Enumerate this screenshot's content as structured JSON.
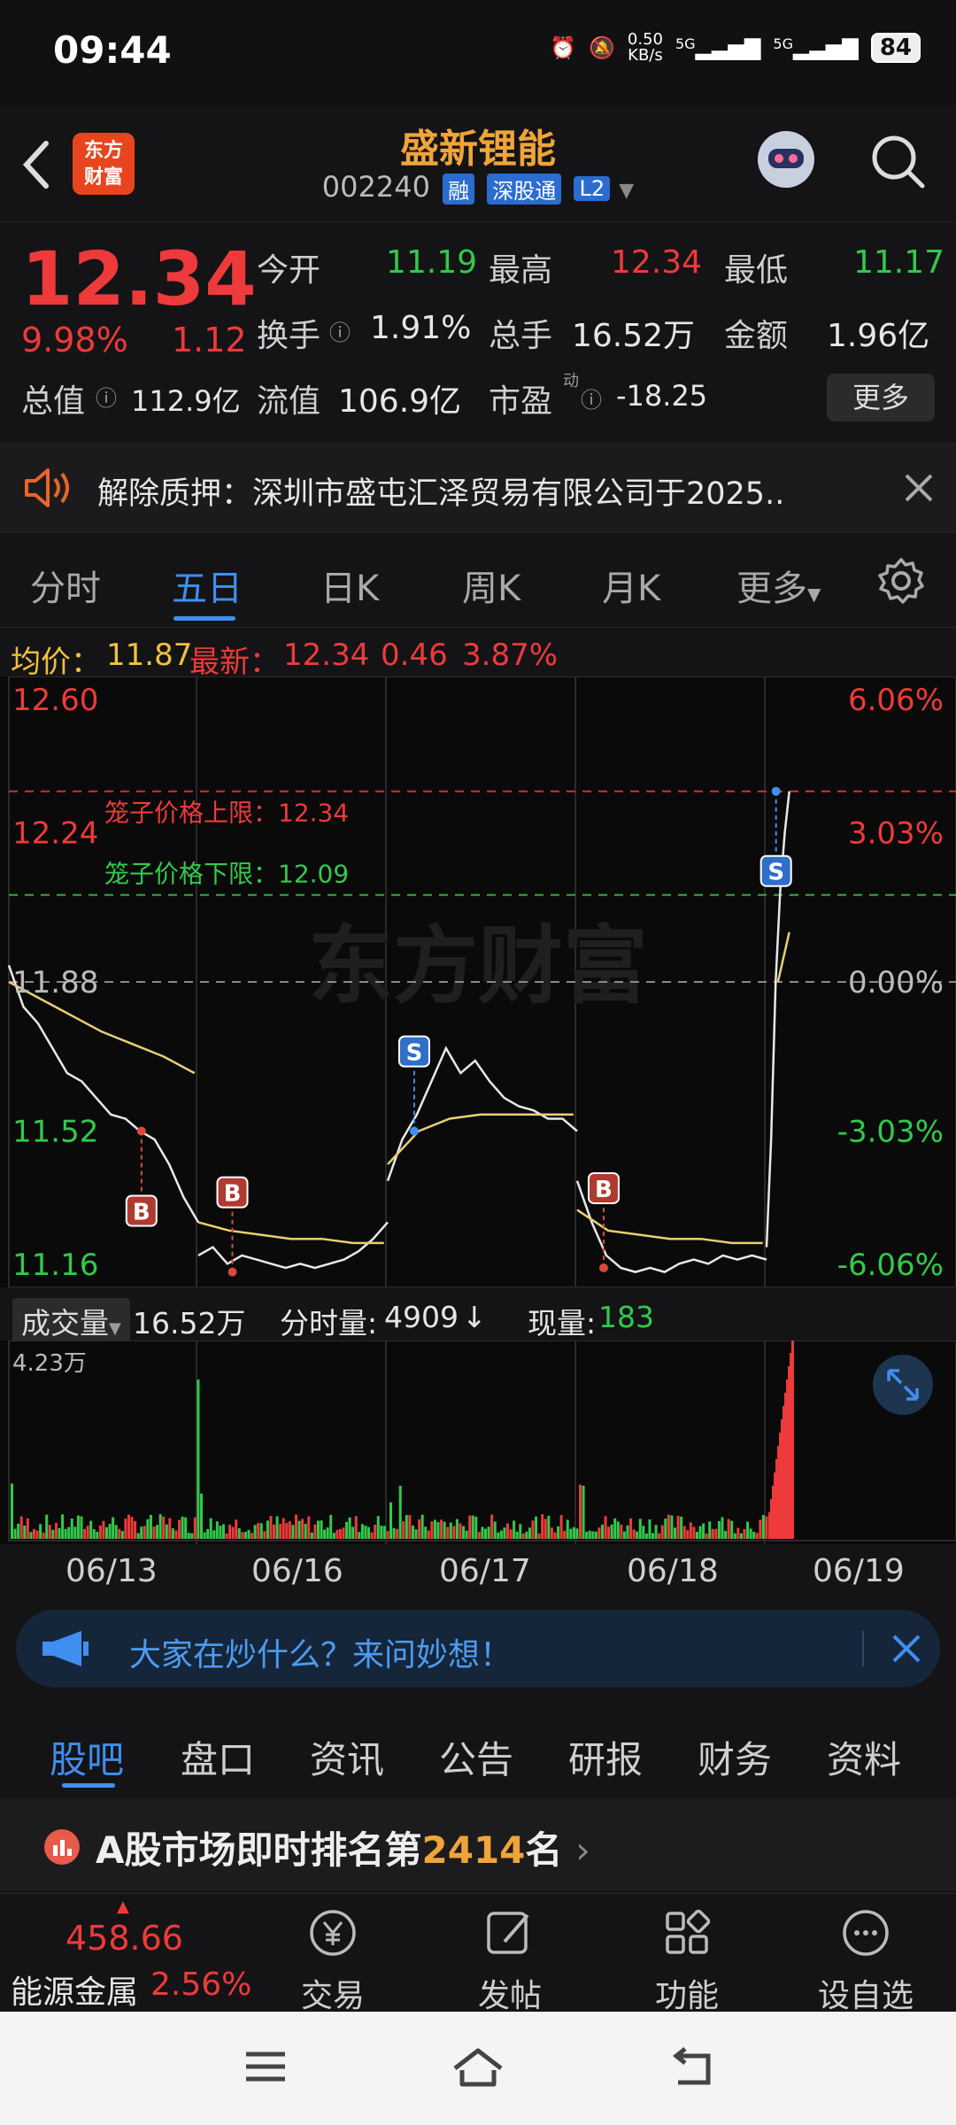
{
  "status_bar": {
    "time": "09:44",
    "net_speed_value": "0.50",
    "net_speed_unit": "KB/s",
    "sim1": "5G",
    "sim2": "5G",
    "battery": "84"
  },
  "header": {
    "logo_line1": "东方",
    "logo_line2": "财富",
    "stock_name": "盛新锂能",
    "stock_code": "002240",
    "tags": [
      "融",
      "深股通",
      "L2"
    ]
  },
  "quote": {
    "price": "12.34",
    "change_pct": "9.98%",
    "change": "1.12",
    "open_label": "今开",
    "open": "11.19",
    "high_label": "最高",
    "high": "12.34",
    "low_label": "最低",
    "low": "11.17",
    "turnover_label": "换手",
    "turnover": "1.91%",
    "volume_label": "总手",
    "volume": "16.52万",
    "amount_label": "金额",
    "amount": "1.96亿",
    "mcap_label": "总值",
    "mcap": "112.9亿",
    "float_label": "流值",
    "float": "106.9亿",
    "pe_label": "市盈",
    "pe_sup": "动",
    "pe": "-18.25",
    "more": "更多"
  },
  "notice": {
    "text": "解除质押：深圳市盛屯汇泽贸易有限公司于2025.."
  },
  "tabs": [
    "分时",
    "五日",
    "日K",
    "周K",
    "月K",
    "更多",
    ""
  ],
  "tabs_active": "五日",
  "chart_info": {
    "avg_label": "均价：",
    "avg": "11.87",
    "last_label": "最新：",
    "last": "12.34",
    "chg": "0.46",
    "chg_pct": "3.87%"
  },
  "chart_data": {
    "type": "line",
    "x": [
      "06/13",
      "06/16",
      "06/17",
      "06/18",
      "06/19"
    ],
    "y_ticks_left": [
      "12.60",
      "12.24",
      "11.88",
      "11.52",
      "11.16"
    ],
    "y_ticks_right": [
      "6.06%",
      "3.03%",
      "0.00%",
      "-3.03%",
      "-6.06%"
    ],
    "ylim": [
      11.16,
      12.6
    ],
    "cage_upper_label": "笼子价格上限：12.34",
    "cage_lower_label": "笼子价格下限：12.09",
    "cage_upper": 12.34,
    "cage_lower": 12.09,
    "prev_close": 11.88,
    "watermark": "东方财富",
    "series": [
      {
        "values_day1": [
          11.92,
          11.82,
          11.78,
          11.72,
          11.66,
          11.64,
          11.6,
          11.56,
          11.55,
          11.52,
          11.5,
          11.44,
          11.36,
          11.3
        ]
      },
      {
        "values_day2": [
          11.22,
          11.24,
          11.2,
          11.22,
          11.21,
          11.2,
          11.19,
          11.2,
          11.19,
          11.2,
          11.21,
          11.23,
          11.26,
          11.3
        ]
      },
      {
        "values_day3": [
          11.4,
          11.5,
          11.56,
          11.64,
          11.72,
          11.66,
          11.69,
          11.64,
          11.6,
          11.58,
          11.57,
          11.55,
          11.55,
          11.52
        ]
      },
      {
        "values_day4": [
          11.4,
          11.3,
          11.22,
          11.19,
          11.18,
          11.19,
          11.18,
          11.2,
          11.21,
          11.2,
          11.22,
          11.21,
          11.22,
          11.21
        ]
      },
      {
        "values_day5": [
          11.24,
          11.5,
          11.88,
          12.1,
          12.24,
          12.34
        ]
      }
    ],
    "avg_series": [
      {
        "values_day1": [
          11.88,
          11.84,
          11.8,
          11.76,
          11.73,
          11.7,
          11.66
        ]
      },
      {
        "values_day2": [
          11.3,
          11.28,
          11.27,
          11.26,
          11.26,
          11.25,
          11.25
        ]
      },
      {
        "values_day3": [
          11.44,
          11.52,
          11.55,
          11.56,
          11.56,
          11.56,
          11.56
        ]
      },
      {
        "values_day4": [
          11.33,
          11.28,
          11.27,
          11.26,
          11.26,
          11.25,
          11.25
        ]
      },
      {
        "values_day5": [
          11.88,
          12.0
        ]
      }
    ],
    "trade_markers": [
      "B",
      "B",
      "S",
      "B",
      "S"
    ],
    "trade_markers_info": "B/S"
  },
  "volume_info": {
    "label": "成交量",
    "total": "16.52万",
    "tick_label": "分时量:",
    "tick": "4909",
    "tick_arrow": "↓",
    "now_label": "现量:",
    "now": "183",
    "max": "4.23万"
  },
  "ask": {
    "text": "大家在炒什么？来问妙想！"
  },
  "bottom_tabs": [
    "股吧",
    "盘口",
    "资讯",
    "公告",
    "研报",
    "财务",
    "资料"
  ],
  "rank": {
    "prefix": "A股市场即时排名第",
    "rank": "2414",
    "suffix": "名"
  },
  "bottom_bar": {
    "sector_value": "458.66",
    "sector_name": "能源金属",
    "sector_pct": "2.56%",
    "items": [
      "交易",
      "发帖",
      "功能",
      "设自选"
    ]
  },
  "colors": {
    "up": "#ee3a3a",
    "down": "#33c94a",
    "accent": "#3f8ff0",
    "brand": "#f0a43a"
  }
}
